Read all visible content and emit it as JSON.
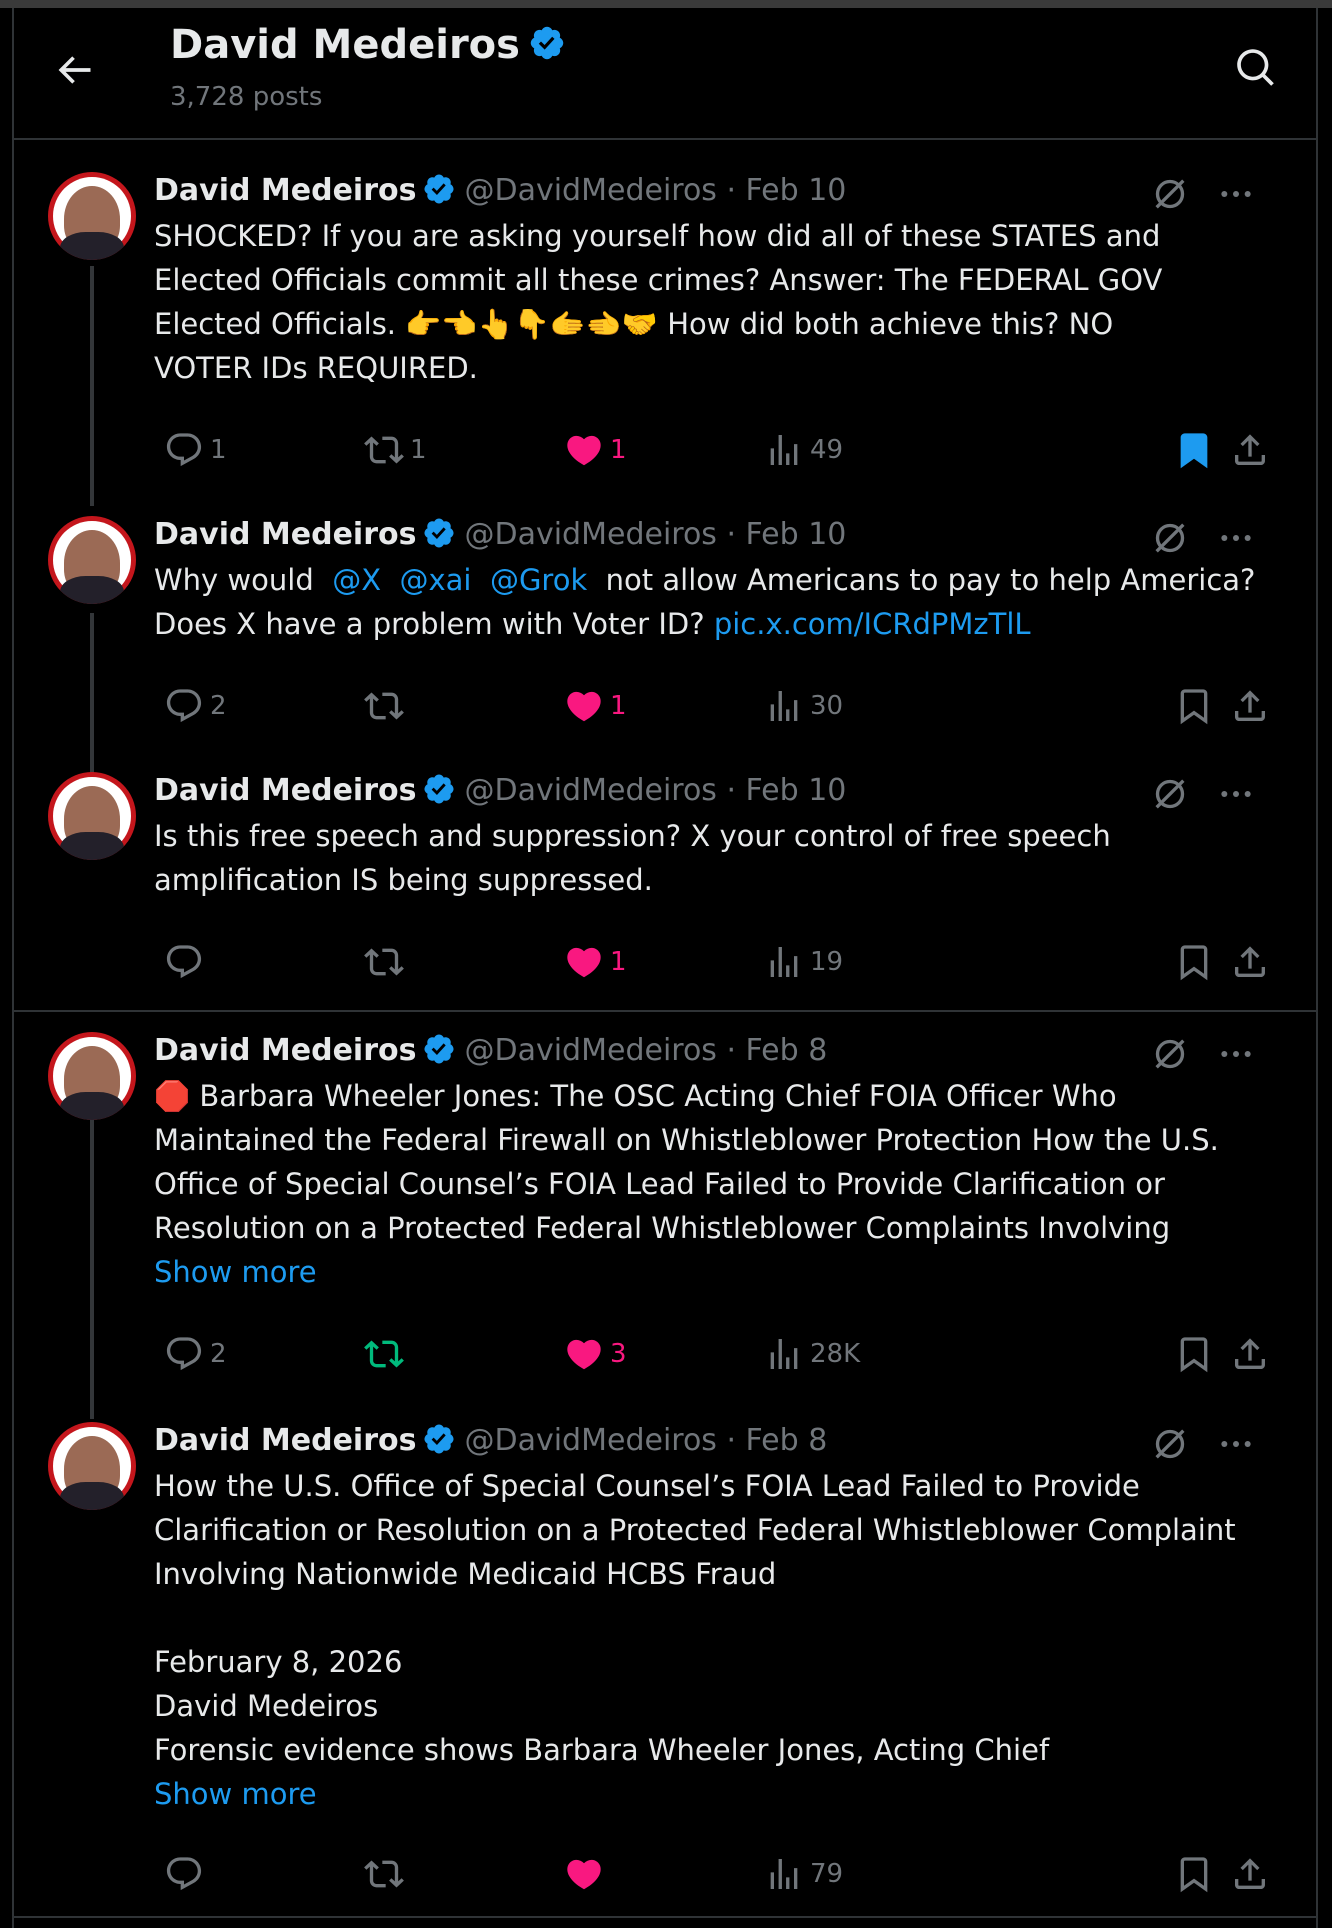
{
  "header": {
    "title": "David Medeiros",
    "posts_count": "3,728 posts"
  },
  "colors": {
    "accent": "#1d9bf0",
    "like": "#f91880",
    "repost": "#00ba7c",
    "muted": "#71767b",
    "bg": "#000000"
  },
  "tweets": [
    {
      "name": "David Medeiros",
      "handle": "@DavidMedeiros",
      "date": "Feb 10",
      "text_lines": [
        "SHOCKED? If you are asking yourself how did all of these STATES and",
        "Elected Officials commit all these crimes? Answer: The FEDERAL GOV",
        "Elected Officials. 👉👈👆👇🫱🫲🤝 How did both achieve this? NO",
        "VOTER IDs REQUIRED."
      ],
      "replies": "1",
      "reposts": "1",
      "likes": "1",
      "views": "49",
      "bookmarked": true,
      "reposted": false,
      "liked": true
    },
    {
      "name": "David Medeiros",
      "handle": "@DavidMedeiros",
      "date": "Feb 10",
      "line1_pre": "Why would ",
      "mentions": [
        "@X",
        "@xai",
        "@Grok"
      ],
      "line1_post": " not allow Americans to pay to help America?",
      "line2_pre": "Does X have a problem with Voter ID? ",
      "link": "pic.x.com/ICRdPMzTlL",
      "replies": "2",
      "reposts": "",
      "likes": "1",
      "views": "30",
      "bookmarked": false,
      "reposted": false,
      "liked": true
    },
    {
      "name": "David Medeiros",
      "handle": "@DavidMedeiros",
      "date": "Feb 10",
      "text_lines": [
        "Is this free speech and suppression? X your control of free speech",
        "amplification IS being suppressed."
      ],
      "replies": "",
      "reposts": "",
      "likes": "1",
      "views": "19",
      "bookmarked": false,
      "reposted": false,
      "liked": true
    },
    {
      "name": "David Medeiros",
      "handle": "@DavidMedeiros",
      "date": "Feb 8",
      "text_lines": [
        "🛑 Barbara Wheeler Jones: The OSC Acting Chief FOIA Officer Who",
        "Maintained the Federal Firewall on Whistleblower Protection How the U.S.",
        "Office of Special Counsel’s FOIA Lead Failed to Provide Clarification or",
        "Resolution on a Protected Federal Whistleblower Complaints Involving"
      ],
      "show_more": "Show more",
      "replies": "2",
      "reposts": "",
      "likes": "3",
      "views": "28K",
      "bookmarked": false,
      "reposted": true,
      "liked": true
    },
    {
      "name": "David Medeiros",
      "handle": "@DavidMedeiros",
      "date": "Feb 8",
      "text_lines": [
        "How the U.S. Office of Special Counsel’s FOIA Lead Failed to Provide",
        "Clarification or Resolution on a Protected Federal Whistleblower Complaint",
        "Involving Nationwide Medicaid HCBS Fraud",
        "",
        "February 8, 2026",
        "David Medeiros",
        "Forensic evidence shows Barbara Wheeler Jones, Acting Chief"
      ],
      "show_more": "Show more",
      "replies": "",
      "reposts": "",
      "likes": "",
      "views": "79",
      "bookmarked": false,
      "reposted": false,
      "liked": true
    }
  ]
}
